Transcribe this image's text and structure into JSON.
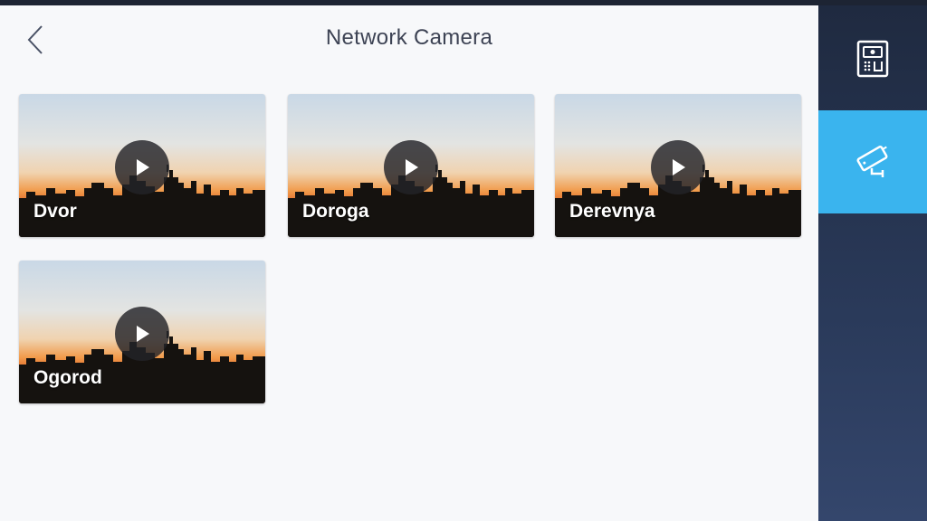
{
  "header": {
    "title": "Network Camera"
  },
  "cameras": [
    {
      "name": "Dvor"
    },
    {
      "name": "Doroga"
    },
    {
      "name": "Derevnya"
    },
    {
      "name": "Ogorod"
    }
  ],
  "sidebar": {
    "items": [
      {
        "icon": "intercom-panel-icon",
        "active": false
      },
      {
        "icon": "security-camera-icon",
        "active": true
      }
    ]
  },
  "colors": {
    "active_tab": "#3ab4ee",
    "sidebar_bg": "#1f2a40",
    "page_bg": "#f7f8fa"
  }
}
